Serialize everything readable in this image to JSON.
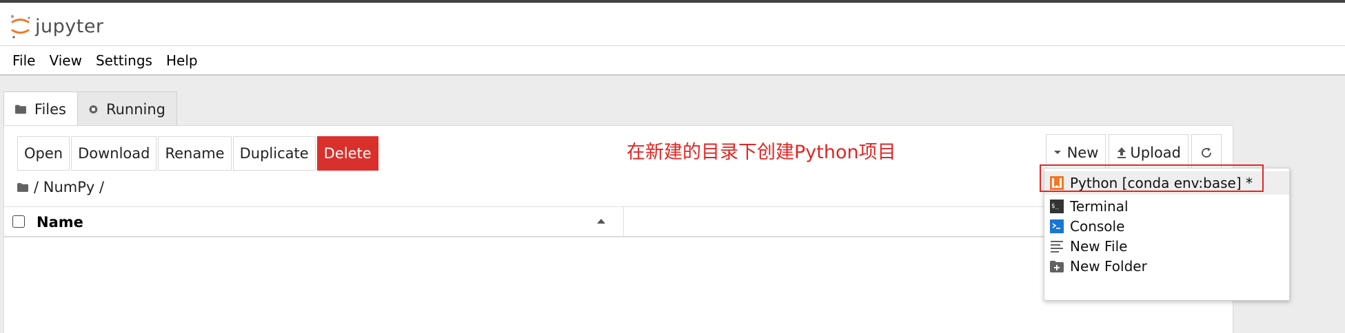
{
  "app": {
    "logo_text": "jupyter"
  },
  "menu": [
    "File",
    "View",
    "Settings",
    "Help"
  ],
  "tabs": [
    {
      "label": "Files",
      "icon": "folder-icon"
    },
    {
      "label": "Running",
      "icon": "stop-circle-icon"
    }
  ],
  "toolbar": {
    "open": "Open",
    "download": "Download",
    "rename": "Rename",
    "duplicate": "Duplicate",
    "delete": "Delete"
  },
  "annotation": "在新建的目录下创建Python项目",
  "right_toolbar": {
    "new": "New",
    "upload": "Upload",
    "refresh_icon": "refresh-icon"
  },
  "breadcrumb": "/ NumPy /",
  "list": {
    "name_header": "Name"
  },
  "new_menu": [
    {
      "label": "Python [conda env:base] *",
      "icon": "notebook-icon"
    },
    {
      "label": "Terminal",
      "icon": "terminal-icon"
    },
    {
      "label": "Console",
      "icon": "console-icon"
    },
    {
      "label": "New File",
      "icon": "file-lines-icon"
    },
    {
      "label": "New Folder",
      "icon": "folder-plus-icon"
    }
  ],
  "colors": {
    "delete_button": "#d9302c",
    "annotation": "#e32522",
    "jupyter_orange": "#f37726"
  }
}
